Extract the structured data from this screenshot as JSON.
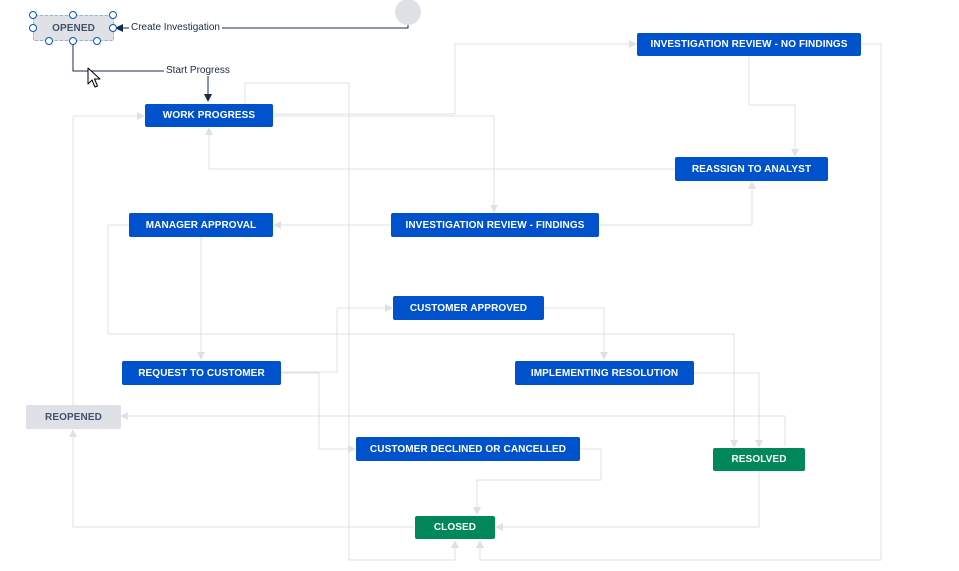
{
  "diagram": {
    "initial": {
      "target": "OPENED"
    },
    "nodes": {
      "opened": "OPENED",
      "work_progress": "WORK PROGRESS",
      "manager_approval": "MANAGER APPROVAL",
      "request_to_customer": "REQUEST TO CUSTOMER",
      "reopened": "REOPENED",
      "investigation_review_no_findings": "INVESTIGATION REVIEW - NO FINDINGS",
      "reassign_to_analyst": "REASSIGN TO ANALYST",
      "investigation_review_findings": "INVESTIGATION REVIEW - FINDINGS",
      "customer_approved": "CUSTOMER APPROVED",
      "implementing_resolution": "IMPLEMENTING RESOLUTION",
      "customer_declined_or_cancelled": "CUSTOMER DECLINED OR CANCELLED",
      "resolved": "RESOLVED",
      "closed": "CLOSED"
    },
    "transition_labels": {
      "create_investigation": "Create Investigation",
      "start_progress": "Start Progress"
    },
    "colors": {
      "in_progress": "#0052cc",
      "done": "#00875a",
      "to_do": "#dfe1e6",
      "connector": "#dfe1e6",
      "active_connector": "#172b4d",
      "selection": "#0052cc"
    },
    "selected_node": "OPENED"
  }
}
